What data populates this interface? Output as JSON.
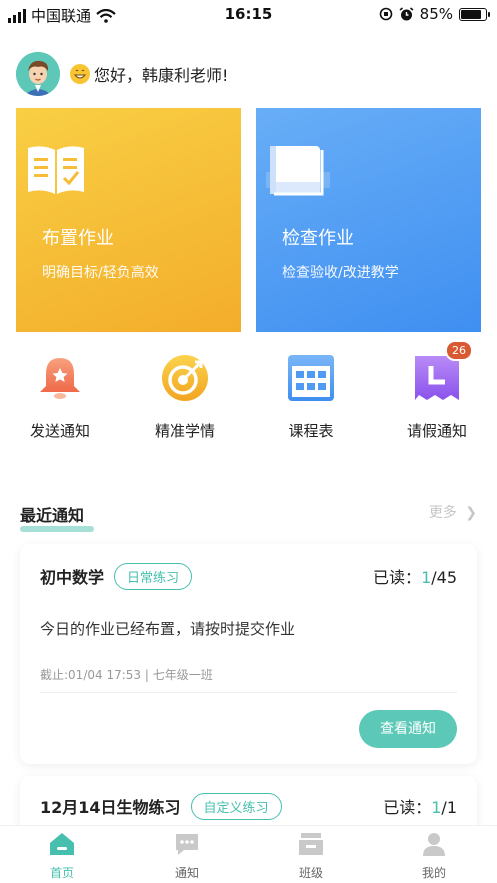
{
  "status_bar": {
    "carrier": "中国联通",
    "time": "16:15",
    "battery_percent": "85%",
    "battery_level": 0.85
  },
  "greeting": {
    "text": "您好，韩康利老师!"
  },
  "cards": [
    {
      "title": "布置作业",
      "subtitle": "明确目标/轻负高效",
      "color": "#f6bd36"
    },
    {
      "title": "检查作业",
      "subtitle": "检查验收/改进教学",
      "color": "#4f9af3"
    }
  ],
  "quick_actions": [
    {
      "label": "发送通知",
      "icon": "bell-icon"
    },
    {
      "label": "精准学情",
      "icon": "target-icon"
    },
    {
      "label": "课程表",
      "icon": "calendar-icon"
    },
    {
      "label": "请假通知",
      "icon": "leave-icon",
      "badge": "26"
    }
  ],
  "recent": {
    "title": "最近通知",
    "more": "更多"
  },
  "notices": [
    {
      "subject": "初中数学",
      "tag": "日常练习",
      "read_label": "已读：",
      "read_count": "1",
      "read_total": "/45",
      "message": "今日的作业已经布置，请按时提交作业",
      "meta": "截止:01/04 17:53 | 七年级一班",
      "button": "查看通知"
    },
    {
      "subject": "12月14日生物练习",
      "tag": "自定义练习",
      "read_label": "已读：",
      "read_count": "1",
      "read_total": "/1"
    }
  ],
  "tabs": [
    {
      "label": "首页",
      "icon": "home-icon",
      "active": true
    },
    {
      "label": "通知",
      "icon": "chat-icon",
      "active": false
    },
    {
      "label": "班级",
      "icon": "class-icon",
      "active": false
    },
    {
      "label": "我的",
      "icon": "profile-icon",
      "active": false
    }
  ],
  "colors": {
    "accent": "#46bfae",
    "badge": "#d95a32"
  }
}
